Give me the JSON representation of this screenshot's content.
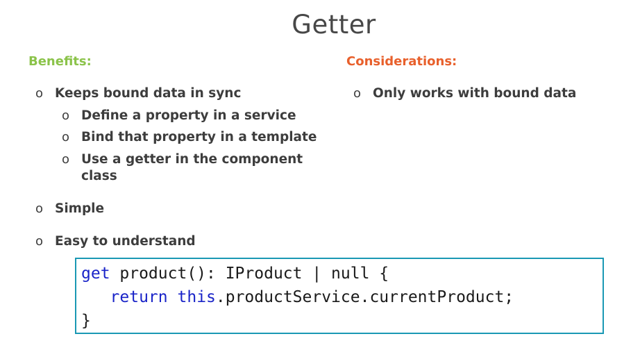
{
  "slide": {
    "title": "Getter",
    "benefits_heading": "Benefits:",
    "considerations_heading": "Considerations:",
    "bullet_mark": "o",
    "benefits": [
      "Keeps bound data in sync",
      "Define a property in a service",
      "Bind that property in a template",
      "Use a getter in the component class",
      "Simple",
      "Easy to understand"
    ],
    "considerations": [
      "Only works with bound data"
    ]
  },
  "code": {
    "line1_kw": "get",
    "line1_rest": " product(): IProduct | null {",
    "line2_indent": "   ",
    "line2_kw1": "return",
    "line2_space": " ",
    "line2_kw2": "this",
    "line2_rest": ".productService.currentProduct;",
    "line3": "}"
  },
  "colors": {
    "benefits_heading": "#8bc34a",
    "considerations_heading": "#e8602c",
    "code_border": "#1a98b4",
    "code_keyword": "#1a24c8"
  }
}
